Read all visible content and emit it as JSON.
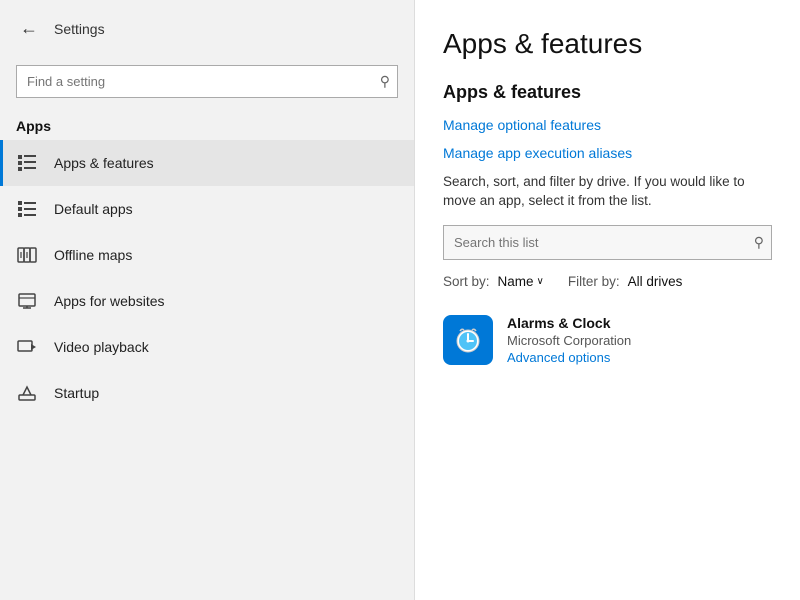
{
  "sidebar": {
    "header": {
      "back_label": "←",
      "title": "Settings"
    },
    "search": {
      "placeholder": "Find a setting",
      "icon": "🔍"
    },
    "section_label": "Apps",
    "nav_items": [
      {
        "id": "apps-features",
        "label": "Apps & features",
        "active": true,
        "icon": "apps-features"
      },
      {
        "id": "default-apps",
        "label": "Default apps",
        "active": false,
        "icon": "default-apps"
      },
      {
        "id": "offline-maps",
        "label": "Offline maps",
        "active": false,
        "icon": "offline-maps"
      },
      {
        "id": "apps-websites",
        "label": "Apps for websites",
        "active": false,
        "icon": "apps-websites"
      },
      {
        "id": "video-playback",
        "label": "Video playback",
        "active": false,
        "icon": "video-playback"
      },
      {
        "id": "startup",
        "label": "Startup",
        "active": false,
        "icon": "startup"
      }
    ]
  },
  "main": {
    "page_title": "Apps & features",
    "section_title": "Apps & features",
    "links": [
      {
        "id": "manage-optional",
        "label": "Manage optional features"
      },
      {
        "id": "manage-aliases",
        "label": "Manage app execution aliases"
      }
    ],
    "description": "Search, sort, and filter by drive. If you would like to move an app, select it from the list.",
    "list_search": {
      "placeholder": "Search this list",
      "icon": "🔍"
    },
    "sort": {
      "label": "Sort by:",
      "value": "Name",
      "chevron": "∨"
    },
    "filter": {
      "label": "Filter by:",
      "value": "All drives"
    },
    "apps": [
      {
        "id": "alarms-clock",
        "name": "Alarms & Clock",
        "publisher": "Microsoft Corporation",
        "advanced_label": "Advanced options"
      }
    ]
  }
}
